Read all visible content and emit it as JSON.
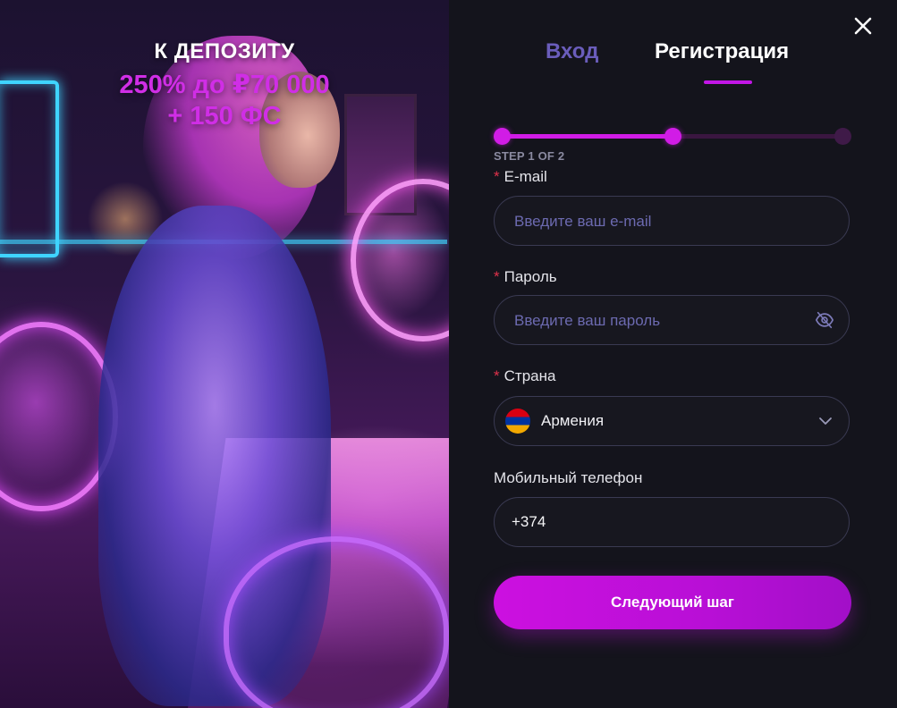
{
  "promo": {
    "title": "К ДЕПОЗИТУ",
    "offer_line1": "250% до ₽70 000",
    "offer_line2": "+ 150 ФС"
  },
  "tabs": {
    "login": "Вход",
    "register": "Регистрация",
    "active": "register"
  },
  "stepper": {
    "label": "STEP 1 OF 2",
    "current_step": 1,
    "total_steps": 2,
    "progress_fraction": 0.5
  },
  "form": {
    "email": {
      "label": "E-mail",
      "required": true,
      "value": "",
      "placeholder": "Введите ваш e-mail"
    },
    "password": {
      "label": "Пароль",
      "required": true,
      "value": "",
      "placeholder": "Введите ваш пароль",
      "visibility_icon": "eye-off-icon"
    },
    "country": {
      "label": "Страна",
      "required": true,
      "value": "Армения",
      "flag_icon": "flag-armenia-icon",
      "dropdown_icon": "chevron-down-icon"
    },
    "phone": {
      "label": "Мобильный телефон",
      "required": false,
      "value": "+374"
    }
  },
  "actions": {
    "next_label": "Следующий шаг",
    "close_icon": "close-icon"
  },
  "colors": {
    "accent": "#c216e6",
    "background": "#14141c",
    "field_border": "#3a3a52",
    "placeholder": "#6c6ab0",
    "required_star": "#e0314b"
  }
}
